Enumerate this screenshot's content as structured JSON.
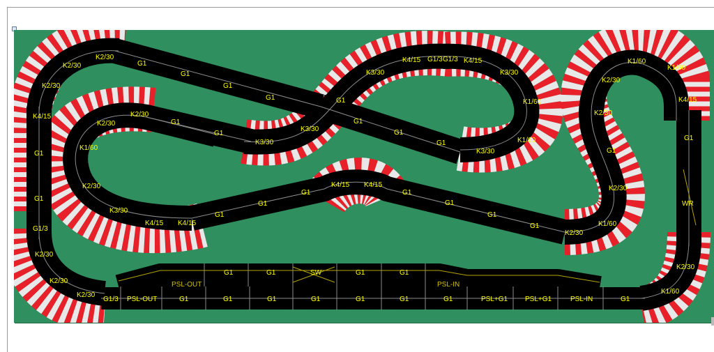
{
  "layout": {
    "title": "",
    "colors": {
      "board": "#2f8f5e",
      "track": "#000000",
      "lane_line": "#8c8c8c",
      "curb_red": "#e8202a",
      "curb_white": "#e8e8e8",
      "label": "#ffff00"
    }
  },
  "pieces": {
    "outer_top_left": {
      "k1": "K2/30",
      "k2": "K2/30",
      "k3": "K2/30",
      "k4": "K4/15",
      "g1": "G1",
      "g2": "G1",
      "g3": "G1/3",
      "k5": "K2/30",
      "k6": "K2/30",
      "k7": "K2/30"
    },
    "top_straight": {
      "a": "G1",
      "b": "G1",
      "c": "G1",
      "d": "G1",
      "e": "G1"
    },
    "inner_loop": {
      "a": "K2/30",
      "b": "K2/30",
      "c": "K1/60",
      "d": "K2/30",
      "e": "K3/30",
      "f": "K4/15",
      "g": "K4/15",
      "s1": "G1",
      "s2": "G1"
    },
    "chicane": {
      "a": "K3/30",
      "b": "K3/30",
      "c": "K3/30",
      "d": "K4/15",
      "e": "G1/3",
      "f": "G1/3",
      "g": "K4/15",
      "h": "K3/30",
      "i": "K1/60",
      "j": "K1/60",
      "k": "K3/30"
    },
    "crossing": {
      "a": "G1",
      "b": "G1",
      "c": "G1",
      "d": "G1"
    },
    "middle": {
      "a": "G1",
      "b": "G1",
      "c": "G1",
      "d": "K4/15",
      "e": "K4/15",
      "f": "G1",
      "g": "G1",
      "h": "G1",
      "i": "G1"
    },
    "right_complex": {
      "a": "K1/60",
      "b": "K1/60",
      "c": "K2/30",
      "d": "K2/30",
      "e": "G1",
      "f": "K2/30",
      "g": "K1/60",
      "h": "K2/30",
      "i": "K4/15",
      "j": "G1",
      "k": "WR",
      "l": "K2/30",
      "m": "K1/60"
    },
    "pit_lane": {
      "a": "G1",
      "b": "G1",
      "c": "SW",
      "d": "G1",
      "e": "G1",
      "f": "PSL-OUT",
      "g": "PSL-IN"
    },
    "bottom_straight": {
      "a": "G1/3",
      "b": "PSL-OUT",
      "c": "G1",
      "d": "G1",
      "e": "G1",
      "f": "G1",
      "g": "G1",
      "h": "G1",
      "i": "G1",
      "j": "PSL+G1",
      "k": "PSL+G1",
      "l": "PSL-IN",
      "m": "G1"
    }
  }
}
